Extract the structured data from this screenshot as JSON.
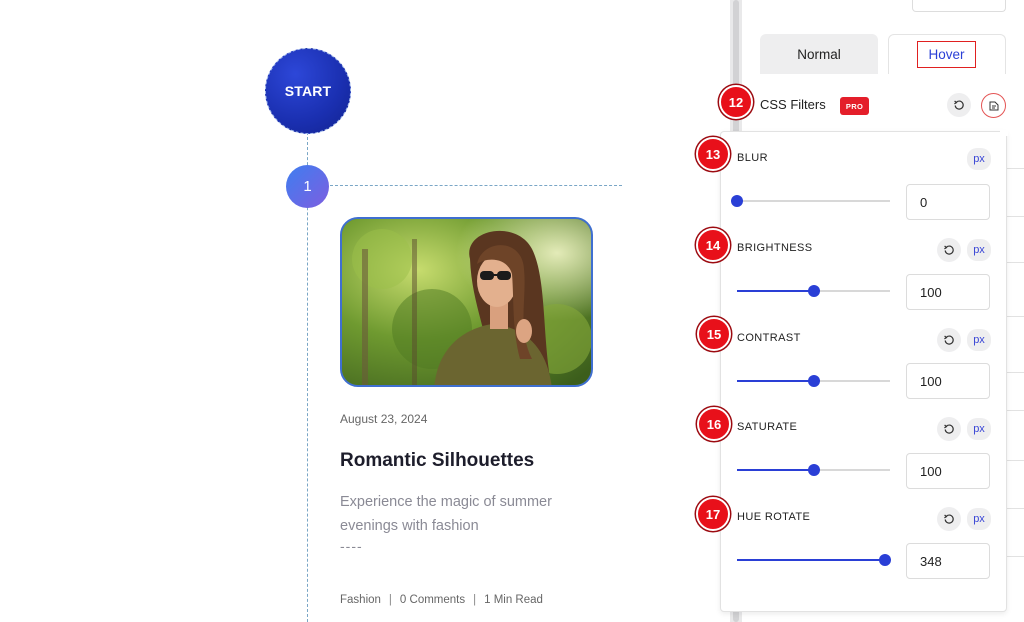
{
  "preview": {
    "start_label": "START",
    "step_number": "1",
    "post": {
      "date": "August 23, 2024",
      "title": "Romantic Silhouettes",
      "excerpt": "Experience the magic of summer evenings with fashion",
      "dashes": "----",
      "category": "Fashion",
      "comments": "0 Comments",
      "read_time": "1 Min Read",
      "separator": "|"
    }
  },
  "panel": {
    "tabs": {
      "normal": "Normal",
      "hover": "Hover"
    },
    "css_filters": {
      "label": "CSS Filters",
      "badge_number": "12",
      "pro_label": "PRO"
    },
    "controls": [
      {
        "badge": "13",
        "label": "BLUR",
        "value": "0",
        "unit": "px",
        "fraction": 0.0,
        "has_reset": false
      },
      {
        "badge": "14",
        "label": "BRIGHTNESS",
        "value": "100",
        "unit": "px",
        "fraction": 0.5,
        "has_reset": true
      },
      {
        "badge": "15",
        "label": "CONTRAST",
        "value": "100",
        "unit": "px",
        "fraction": 0.5,
        "has_reset": true
      },
      {
        "badge": "16",
        "label": "SATURATE",
        "value": "100",
        "unit": "px",
        "fraction": 0.5,
        "has_reset": true
      },
      {
        "badge": "17",
        "label": "HUE ROTATE",
        "value": "348",
        "unit": "px",
        "fraction": 0.967,
        "has_reset": true
      }
    ]
  },
  "colors": {
    "accent": "#2a3fd6",
    "badge_red": "#e8101a",
    "pro_red": "#e41e2a",
    "start_blue": "#1a2fb0"
  }
}
